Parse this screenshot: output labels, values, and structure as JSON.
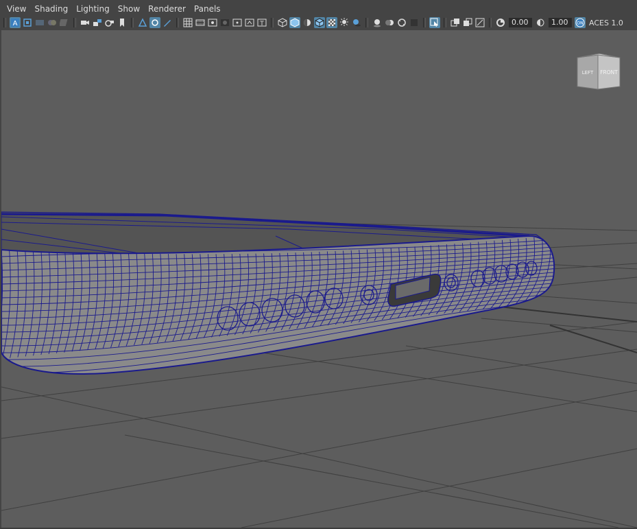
{
  "menu": {
    "items": [
      {
        "id": "view",
        "label": "View"
      },
      {
        "id": "shading",
        "label": "Shading"
      },
      {
        "id": "lighting",
        "label": "Lighting"
      },
      {
        "id": "show",
        "label": "Show"
      },
      {
        "id": "renderer",
        "label": "Renderer"
      },
      {
        "id": "panels",
        "label": "Panels"
      }
    ]
  },
  "toolbar": {
    "exposure_value": "0.00",
    "gamma_value": "1.00",
    "color_space_label": "ACES 1.0",
    "icons": [
      "select-camera-icon",
      "camera-attributes-icon",
      "bookmark-icon",
      "image-plane-icon",
      "grid-icon",
      "film-gate-icon",
      "resolution-gate-icon",
      "wireframe-icon",
      "smooth-shade-icon",
      "textured-icon",
      "lights-icon",
      "shadows-icon",
      "ambient-occlusion-icon",
      "isolate-select-icon",
      "xray-icon",
      "exposure-icon",
      "gamma-icon",
      "color-management-icon"
    ]
  },
  "viewcube": {
    "left_face": "LEFT",
    "front_face": "FRONT"
  },
  "colors": {
    "viewport_bg": "#5d5d5d",
    "ui_bg": "#444444",
    "wireframe": "#1a1a8c",
    "grid_line": "#3a3a3a",
    "toolbar_active": "#5285a6"
  }
}
